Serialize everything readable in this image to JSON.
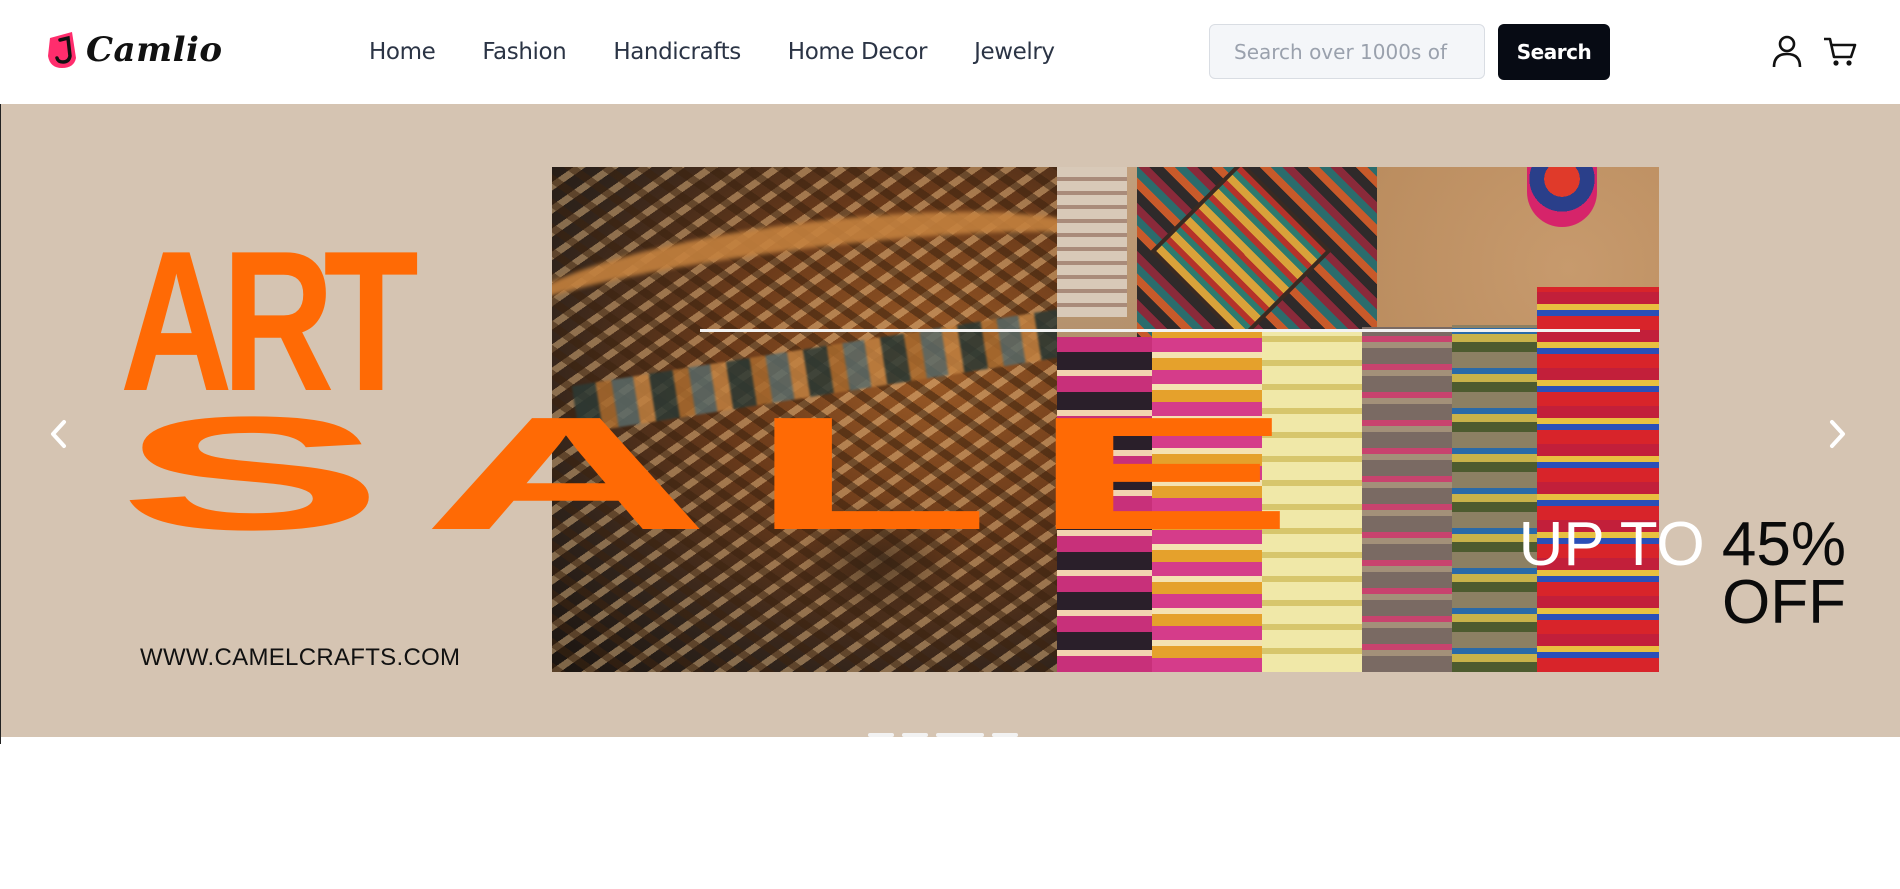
{
  "header": {
    "logo_text": "Camlio",
    "nav": [
      "Home",
      "Fashion",
      "Handicrafts",
      "Home Decor",
      "Jewelry"
    ],
    "search": {
      "placeholder": "Search over 1000s of",
      "value": ""
    },
    "search_button": "Search",
    "icons": [
      "user-icon",
      "cart-icon"
    ]
  },
  "hero": {
    "headline_top": "ART",
    "headline_bottom": "SALE",
    "website": "WWW.CAMELCRAFTS.COM",
    "offer_line1_white": "UP TO",
    "offer_line1_dark": " 45%",
    "offer_line2": "OFF",
    "accent_color": "#ff6a05",
    "background_color": "#d5c4b2",
    "carousel": {
      "slides": 4,
      "active_slide": 3
    },
    "arrow_icons": [
      "chevron-left-icon",
      "chevron-right-icon"
    ]
  }
}
